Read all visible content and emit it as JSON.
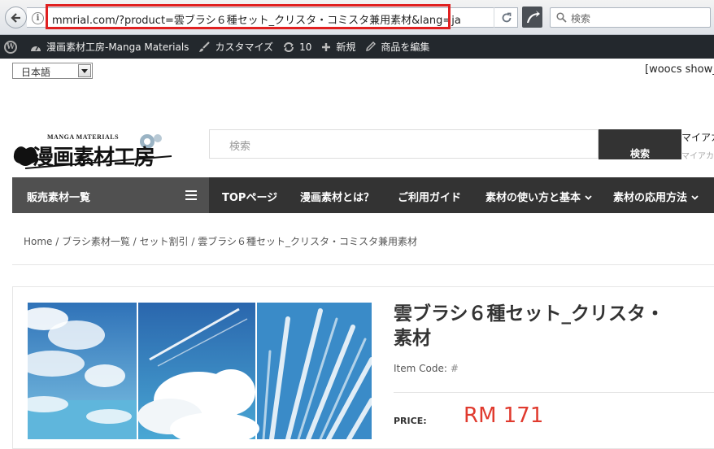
{
  "browser": {
    "url": "mmrial.com/?product=雲ブラシ６種セット_クリスタ・コミスタ兼用素材&lang=ja",
    "search_placeholder": "検索"
  },
  "adminbar": {
    "site_name": "漫画素材工房-Manga Materials",
    "customize": "カスタマイズ",
    "updates_count": "10",
    "new": "新規",
    "edit_product": "商品を編集"
  },
  "header": {
    "language": "日本語",
    "woocs": "[woocs show_",
    "logo_caption": "MANGA MATERIALS",
    "logo_text": "漫画素材工房",
    "search_placeholder": "検索",
    "search_button": "検索",
    "my_account": "マイアカ",
    "my_account_sub": "マイアカ"
  },
  "nav": {
    "categories": "販売素材一覧",
    "items": [
      "TOPページ",
      "漫画素材とは？",
      "ご利用ガイド",
      "素材の使い方と基本",
      "素材の応用方法"
    ]
  },
  "breadcrumb": "Home / ブラシ素材一覧 / セット割引 / 雲ブラシ６種セット_クリスタ・コミスタ兼用素材",
  "product": {
    "title_line1": "雲ブラシ６種セット_クリスタ・",
    "title_line2": "素材",
    "item_code_label": "Item Code:",
    "item_code_value": "#",
    "price_label": "PRICE:",
    "price": "RM 171"
  },
  "colors": {
    "accent_red": "#e02020",
    "price": "#e03a2e",
    "nav_bg": "#333333",
    "nav_active": "#505050",
    "adminbar_bg": "#23282d"
  }
}
